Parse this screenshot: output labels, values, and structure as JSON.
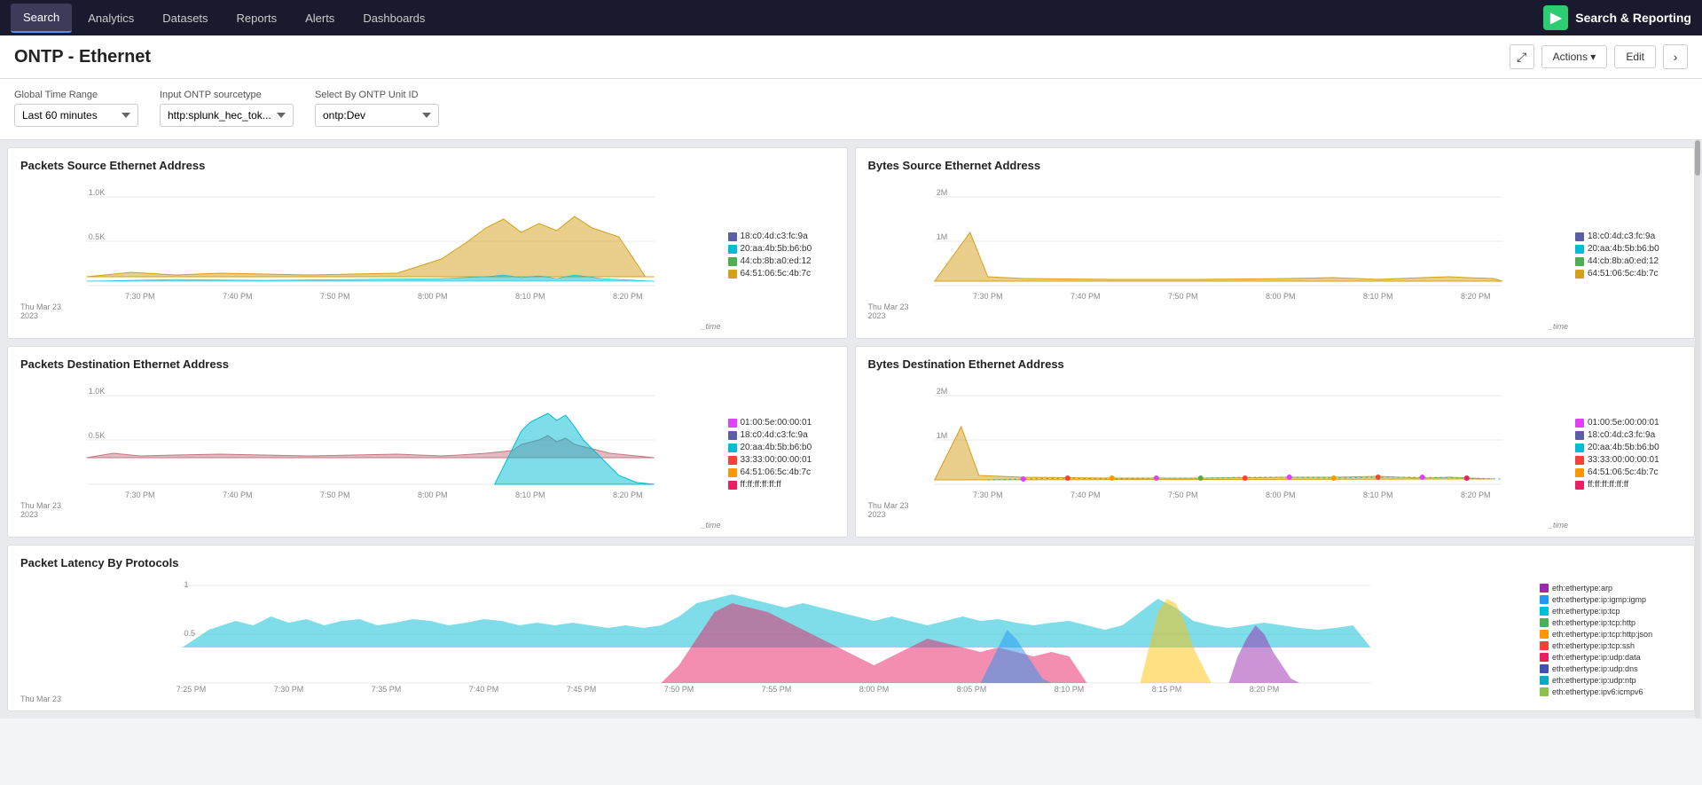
{
  "nav": {
    "items": [
      {
        "label": "Search",
        "active": true
      },
      {
        "label": "Analytics",
        "active": false
      },
      {
        "label": "Datasets",
        "active": false
      },
      {
        "label": "Reports",
        "active": false
      },
      {
        "label": "Alerts",
        "active": false
      },
      {
        "label": "Dashboards",
        "active": false
      }
    ],
    "brand_label": "Search & Reporting",
    "brand_icon": "▶"
  },
  "header": {
    "title": "ONTP - Ethernet",
    "expand_label": "⤢",
    "actions_label": "Actions ▾",
    "edit_label": "Edit",
    "next_label": "›"
  },
  "filters": {
    "global_time_label": "Global Time Range",
    "global_time_value": "Last 60 minutes",
    "input_ontp_label": "Input ONTP sourcetype",
    "input_ontp_value": "http:splunk_hec_tok...",
    "select_unit_label": "Select By ONTP Unit ID",
    "select_unit_value": "ontp:Dev"
  },
  "charts": {
    "packets_src": {
      "title": "Packets Source Ethernet Address",
      "y_max": "1.0K",
      "y_mid": "0.5K",
      "x_labels": [
        "7:30 PM",
        "7:40 PM",
        "7:50 PM",
        "8:00 PM",
        "8:10 PM",
        "8:20 PM"
      ],
      "date_label": "Thu Mar 23\n2023",
      "time_axis": "_time",
      "legend": [
        {
          "color": "#5b5ea6",
          "label": "18:c0:4d:c3:fc:9a"
        },
        {
          "color": "#00bcd4",
          "label": "20:aa:4b:5b:b6:b0"
        },
        {
          "color": "#4caf50",
          "label": "44:cb:8b:a0:ed:12"
        },
        {
          "color": "#d4a017",
          "label": "64:51:06:5c:4b:7c"
        }
      ]
    },
    "bytes_src": {
      "title": "Bytes Source Ethernet Address",
      "y_max": "2M",
      "y_mid": "1M",
      "x_labels": [
        "7:30 PM",
        "7:40 PM",
        "7:50 PM",
        "8:00 PM",
        "8:10 PM",
        "8:20 PM"
      ],
      "date_label": "Thu Mar 23\n2023",
      "time_axis": "_time",
      "legend": [
        {
          "color": "#5b5ea6",
          "label": "18:c0:4d:c3:fc:9a"
        },
        {
          "color": "#00bcd4",
          "label": "20:aa:4b:5b:b6:b0"
        },
        {
          "color": "#4caf50",
          "label": "44:cb:8b:a0:ed:12"
        },
        {
          "color": "#d4a017",
          "label": "64:51:06:5c:4b:7c"
        }
      ]
    },
    "packets_dst": {
      "title": "Packets Destination Ethernet Address",
      "y_max": "1.0K",
      "y_mid": "0.5K",
      "x_labels": [
        "7:30 PM",
        "7:40 PM",
        "7:50 PM",
        "8:00 PM",
        "8:10 PM",
        "8:20 PM"
      ],
      "date_label": "Thu Mar 23\n2023",
      "time_axis": "_time",
      "legend": [
        {
          "color": "#e040fb",
          "label": "01:00:5e:00:00:01"
        },
        {
          "color": "#5b5ea6",
          "label": "18:c0:4d:c3:fc:9a"
        },
        {
          "color": "#00bcd4",
          "label": "20:aa:4b:5b:b6:b0"
        },
        {
          "color": "#f44336",
          "label": "33:33:00:00:00:01"
        },
        {
          "color": "#ff9800",
          "label": "64:51:06:5c:4b:7c"
        },
        {
          "color": "#e91e63",
          "label": "ff:ff:ff:ff:ff:ff"
        }
      ]
    },
    "bytes_dst": {
      "title": "Bytes Destination Ethernet Address",
      "y_max": "2M",
      "y_mid": "1M",
      "x_labels": [
        "7:30 PM",
        "7:40 PM",
        "7:50 PM",
        "8:00 PM",
        "8:10 PM",
        "8:20 PM"
      ],
      "date_label": "Thu Mar 23\n2023",
      "time_axis": "_time",
      "legend": [
        {
          "color": "#e040fb",
          "label": "01:00:5e:00:00:01"
        },
        {
          "color": "#5b5ea6",
          "label": "18:c0:4d:c3:fc:9a"
        },
        {
          "color": "#00bcd4",
          "label": "20:aa:4b:5b:b6:b0"
        },
        {
          "color": "#f44336",
          "label": "33:33:00:00:00:01"
        },
        {
          "color": "#ff9800",
          "label": "64:51:06:5c:4b:7c"
        },
        {
          "color": "#e91e63",
          "label": "ff:ff:ff:ff:ff:ff"
        }
      ]
    },
    "packet_latency": {
      "title": "Packet Latency By Protocols",
      "y_max": "1",
      "y_mid": "0.5",
      "x_labels": [
        "7:25 PM",
        "7:30 PM",
        "7:35 PM",
        "7:40 PM",
        "7:45 PM",
        "7:50 PM",
        "7:55 PM",
        "8:00 PM",
        "8:05 PM",
        "8:10 PM",
        "8:15 PM",
        "8:20 PM"
      ],
      "date_label": "Thu Mar 23",
      "legend": [
        {
          "color": "#9c27b0",
          "label": "eth:ethertype:arp"
        },
        {
          "color": "#2196f3",
          "label": "eth:ethertype:ip:igmp:igmp"
        },
        {
          "color": "#00bcd4",
          "label": "eth:ethertype:ip:tcp"
        },
        {
          "color": "#4caf50",
          "label": "eth:ethertype:ip:tcp:http"
        },
        {
          "color": "#ff9800",
          "label": "eth:ethertype:ip:tcp:http:json"
        },
        {
          "color": "#f44336",
          "label": "eth:ethertype:ip:tcp:ssh"
        },
        {
          "color": "#e91e63",
          "label": "eth:ethertype:ip:udp:data"
        },
        {
          "color": "#3f51b5",
          "label": "eth:ethertype:ip:udp:dns"
        },
        {
          "color": "#00acc1",
          "label": "eth:ethertype:ip:udp:ntp"
        },
        {
          "color": "#8bc34a",
          "label": "eth:ethertype:ipv6:icmpv6"
        }
      ]
    }
  }
}
